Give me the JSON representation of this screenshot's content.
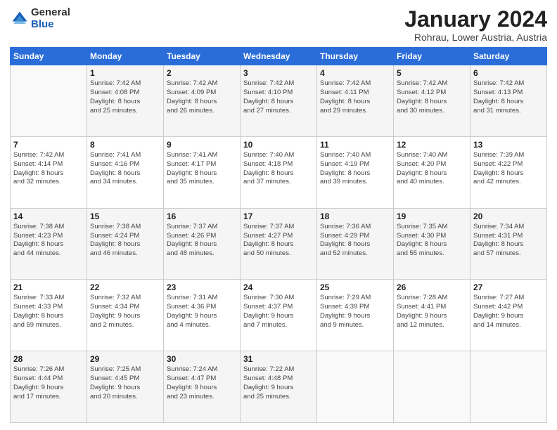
{
  "logo": {
    "general": "General",
    "blue": "Blue"
  },
  "title": "January 2024",
  "location": "Rohrau, Lower Austria, Austria",
  "weekdays": [
    "Sunday",
    "Monday",
    "Tuesday",
    "Wednesday",
    "Thursday",
    "Friday",
    "Saturday"
  ],
  "weeks": [
    [
      {
        "day": "",
        "info": ""
      },
      {
        "day": "1",
        "info": "Sunrise: 7:42 AM\nSunset: 4:08 PM\nDaylight: 8 hours\nand 25 minutes."
      },
      {
        "day": "2",
        "info": "Sunrise: 7:42 AM\nSunset: 4:09 PM\nDaylight: 8 hours\nand 26 minutes."
      },
      {
        "day": "3",
        "info": "Sunrise: 7:42 AM\nSunset: 4:10 PM\nDaylight: 8 hours\nand 27 minutes."
      },
      {
        "day": "4",
        "info": "Sunrise: 7:42 AM\nSunset: 4:11 PM\nDaylight: 8 hours\nand 29 minutes."
      },
      {
        "day": "5",
        "info": "Sunrise: 7:42 AM\nSunset: 4:12 PM\nDaylight: 8 hours\nand 30 minutes."
      },
      {
        "day": "6",
        "info": "Sunrise: 7:42 AM\nSunset: 4:13 PM\nDaylight: 8 hours\nand 31 minutes."
      }
    ],
    [
      {
        "day": "7",
        "info": "Sunrise: 7:42 AM\nSunset: 4:14 PM\nDaylight: 8 hours\nand 32 minutes."
      },
      {
        "day": "8",
        "info": "Sunrise: 7:41 AM\nSunset: 4:16 PM\nDaylight: 8 hours\nand 34 minutes."
      },
      {
        "day": "9",
        "info": "Sunrise: 7:41 AM\nSunset: 4:17 PM\nDaylight: 8 hours\nand 35 minutes."
      },
      {
        "day": "10",
        "info": "Sunrise: 7:40 AM\nSunset: 4:18 PM\nDaylight: 8 hours\nand 37 minutes."
      },
      {
        "day": "11",
        "info": "Sunrise: 7:40 AM\nSunset: 4:19 PM\nDaylight: 8 hours\nand 39 minutes."
      },
      {
        "day": "12",
        "info": "Sunrise: 7:40 AM\nSunset: 4:20 PM\nDaylight: 8 hours\nand 40 minutes."
      },
      {
        "day": "13",
        "info": "Sunrise: 7:39 AM\nSunset: 4:22 PM\nDaylight: 8 hours\nand 42 minutes."
      }
    ],
    [
      {
        "day": "14",
        "info": "Sunrise: 7:38 AM\nSunset: 4:23 PM\nDaylight: 8 hours\nand 44 minutes."
      },
      {
        "day": "15",
        "info": "Sunrise: 7:38 AM\nSunset: 4:24 PM\nDaylight: 8 hours\nand 46 minutes."
      },
      {
        "day": "16",
        "info": "Sunrise: 7:37 AM\nSunset: 4:26 PM\nDaylight: 8 hours\nand 48 minutes."
      },
      {
        "day": "17",
        "info": "Sunrise: 7:37 AM\nSunset: 4:27 PM\nDaylight: 8 hours\nand 50 minutes."
      },
      {
        "day": "18",
        "info": "Sunrise: 7:36 AM\nSunset: 4:29 PM\nDaylight: 8 hours\nand 52 minutes."
      },
      {
        "day": "19",
        "info": "Sunrise: 7:35 AM\nSunset: 4:30 PM\nDaylight: 8 hours\nand 55 minutes."
      },
      {
        "day": "20",
        "info": "Sunrise: 7:34 AM\nSunset: 4:31 PM\nDaylight: 8 hours\nand 57 minutes."
      }
    ],
    [
      {
        "day": "21",
        "info": "Sunrise: 7:33 AM\nSunset: 4:33 PM\nDaylight: 8 hours\nand 59 minutes."
      },
      {
        "day": "22",
        "info": "Sunrise: 7:32 AM\nSunset: 4:34 PM\nDaylight: 9 hours\nand 2 minutes."
      },
      {
        "day": "23",
        "info": "Sunrise: 7:31 AM\nSunset: 4:36 PM\nDaylight: 9 hours\nand 4 minutes."
      },
      {
        "day": "24",
        "info": "Sunrise: 7:30 AM\nSunset: 4:37 PM\nDaylight: 9 hours\nand 7 minutes."
      },
      {
        "day": "25",
        "info": "Sunrise: 7:29 AM\nSunset: 4:39 PM\nDaylight: 9 hours\nand 9 minutes."
      },
      {
        "day": "26",
        "info": "Sunrise: 7:28 AM\nSunset: 4:41 PM\nDaylight: 9 hours\nand 12 minutes."
      },
      {
        "day": "27",
        "info": "Sunrise: 7:27 AM\nSunset: 4:42 PM\nDaylight: 9 hours\nand 14 minutes."
      }
    ],
    [
      {
        "day": "28",
        "info": "Sunrise: 7:26 AM\nSunset: 4:44 PM\nDaylight: 9 hours\nand 17 minutes."
      },
      {
        "day": "29",
        "info": "Sunrise: 7:25 AM\nSunset: 4:45 PM\nDaylight: 9 hours\nand 20 minutes."
      },
      {
        "day": "30",
        "info": "Sunrise: 7:24 AM\nSunset: 4:47 PM\nDaylight: 9 hours\nand 23 minutes."
      },
      {
        "day": "31",
        "info": "Sunrise: 7:22 AM\nSunset: 4:48 PM\nDaylight: 9 hours\nand 25 minutes."
      },
      {
        "day": "",
        "info": ""
      },
      {
        "day": "",
        "info": ""
      },
      {
        "day": "",
        "info": ""
      }
    ]
  ]
}
